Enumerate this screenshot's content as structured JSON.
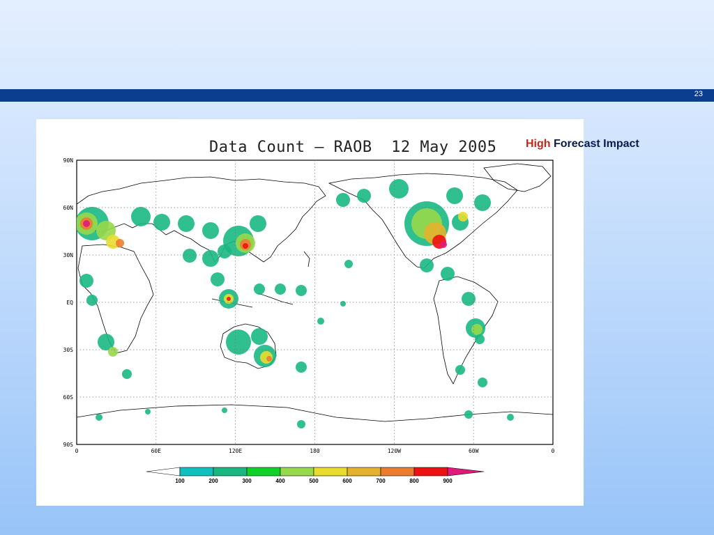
{
  "slide": {
    "number": "23"
  },
  "annotation": {
    "highlight": "High",
    "rest": "Forecast Impact"
  },
  "map": {
    "title": "Data Count – RAOB  12 May 2005",
    "lat_labels": [
      "90N",
      "60N",
      "30N",
      "EQ",
      "30S",
      "60S",
      "90S"
    ],
    "lon_labels": [
      "0",
      "60E",
      "120E",
      "180",
      "120W",
      "60W",
      "0"
    ],
    "colorbar": {
      "labels": [
        "100",
        "200",
        "300",
        "400",
        "500",
        "600",
        "700",
        "800",
        "900"
      ],
      "colors": [
        "#12bfbf",
        "#19b882",
        "#10d12a",
        "#98d84b",
        "#e8dd2f",
        "#e4b22e",
        "#ec7d2f",
        "#ee1111",
        "#e01a7c"
      ]
    }
  }
}
